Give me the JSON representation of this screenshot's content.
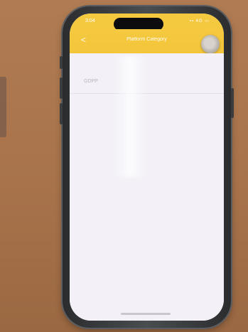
{
  "status_bar": {
    "time": "3:04",
    "icons": "▪▪ 4G ▭"
  },
  "header": {
    "title": "Platform Category",
    "back_glyph": "<",
    "accent_color": "#f5c93f"
  },
  "list": {
    "items": [
      {
        "label": "GDPP"
      }
    ]
  },
  "colors": {
    "header_bg": "#f5c93f",
    "content_bg": "#f3f1f7"
  },
  "icons": [
    "chevron-left-icon",
    "assistive-touch-icon"
  ]
}
